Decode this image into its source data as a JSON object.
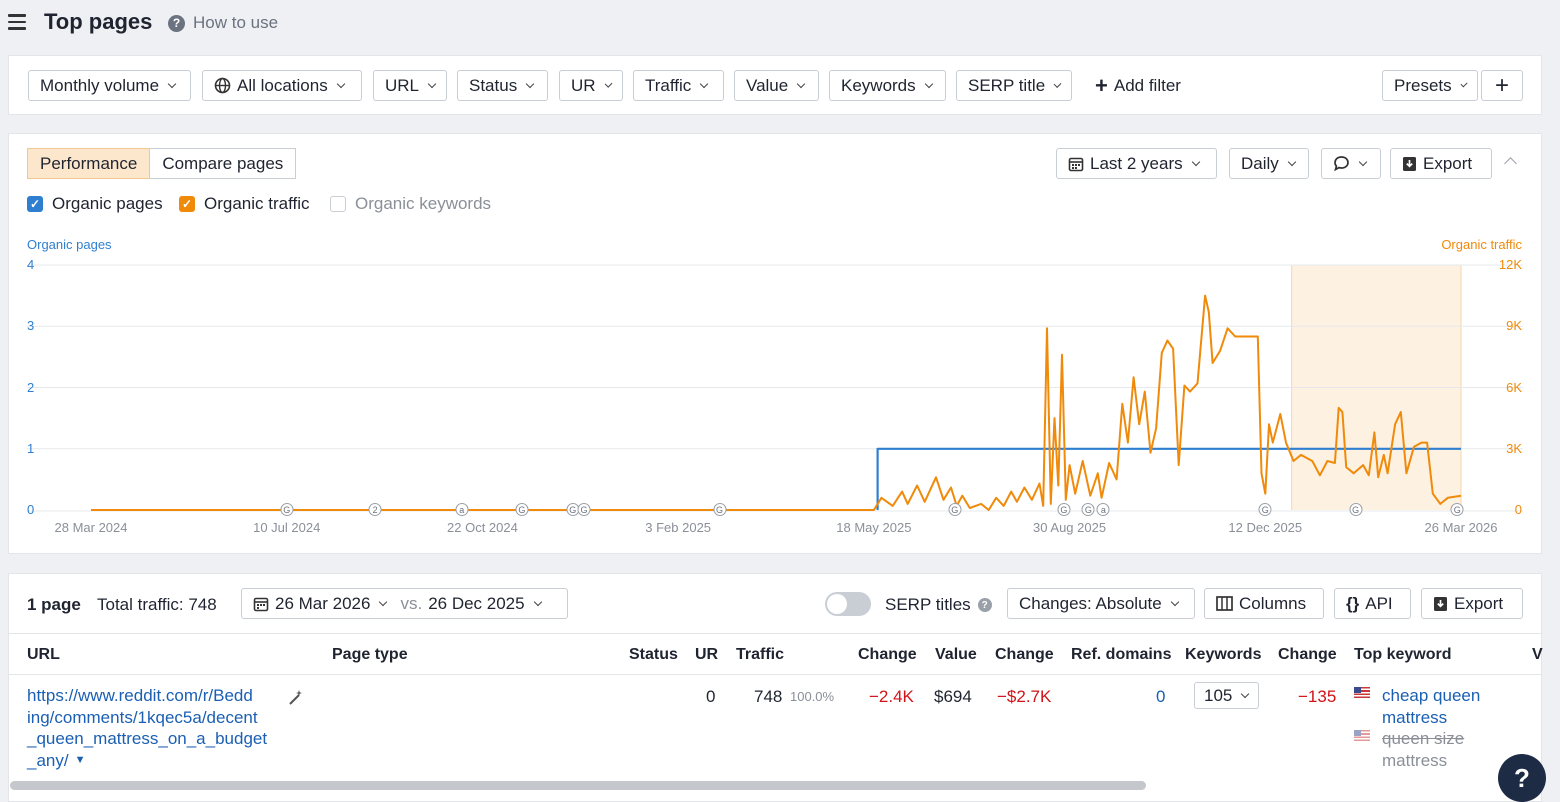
{
  "header": {
    "title": "Top pages",
    "how_to": "How to use",
    "help_glyph": "?"
  },
  "filters": {
    "monthly_volume": "Monthly volume",
    "all_locations": "All locations",
    "url": "URL",
    "status": "Status",
    "ur": "UR",
    "traffic": "Traffic",
    "value": "Value",
    "keywords": "Keywords",
    "serp_title": "SERP title",
    "add_filter": "Add filter",
    "presets": "Presets"
  },
  "chart_panel": {
    "tabs": [
      "Performance",
      "Compare pages"
    ],
    "date_range": "Last 2 years",
    "interval": "Daily",
    "export": "Export",
    "checkboxes": [
      {
        "label": "Organic pages",
        "checked": true,
        "color": "#2f7fd1"
      },
      {
        "label": "Organic traffic",
        "checked": true,
        "color": "#f08a0a"
      },
      {
        "label": "Organic keywords",
        "checked": false,
        "color": "#c9cdd4"
      }
    ]
  },
  "chart_data": {
    "type": "line",
    "left_axis_title": "Organic pages",
    "right_axis_title": "Organic traffic",
    "left_ticks": [
      "0",
      "1",
      "2",
      "3",
      "4"
    ],
    "right_ticks": [
      "0",
      "3K",
      "6K",
      "9K",
      "12K"
    ],
    "ylim_left": [
      0,
      4
    ],
    "ylim_right": [
      0,
      12000
    ],
    "x_ticks": [
      "28 Mar 2024",
      "10 Jul 2024",
      "22 Oct 2024",
      "3 Feb 2025",
      "18 May 2025",
      "30 Aug 2025",
      "12 Dec 2025",
      "26 Mar 2026"
    ],
    "highlight_range": [
      "26 Dec 2025",
      "26 Mar 2026"
    ],
    "grid": true,
    "annotation_markers": [
      {
        "date": "2024-07-10",
        "label": "G"
      },
      {
        "date": "2024-08-26",
        "label": "2"
      },
      {
        "date": "2024-10-11",
        "label": "a"
      },
      {
        "date": "2024-11-12",
        "label": "G"
      },
      {
        "date": "2024-12-09",
        "label": "G"
      },
      {
        "date": "2024-12-15",
        "label": "G"
      },
      {
        "date": "2025-02-25",
        "label": "G"
      },
      {
        "date": "2025-06-30",
        "label": "G"
      },
      {
        "date": "2025-08-27",
        "label": "G"
      },
      {
        "date": "2025-09-09",
        "label": "G"
      },
      {
        "date": "2025-09-17",
        "label": "a"
      },
      {
        "date": "2025-12-12",
        "label": "G"
      },
      {
        "date": "2026-01-29",
        "label": "G"
      },
      {
        "date": "2026-03-24",
        "label": "G"
      }
    ],
    "series": [
      {
        "name": "Organic pages",
        "axis": "left",
        "color": "#2f7fd1",
        "points": [
          [
            "2025-05-20",
            0
          ],
          [
            "2025-05-20",
            1
          ],
          [
            "2026-03-26",
            1
          ]
        ]
      },
      {
        "name": "Organic traffic",
        "axis": "right",
        "color": "#f08a0a",
        "points": [
          [
            "2024-03-28",
            0
          ],
          [
            "2025-05-18",
            0
          ],
          [
            "2025-05-22",
            600
          ],
          [
            "2025-05-28",
            200
          ],
          [
            "2025-06-02",
            900
          ],
          [
            "2025-06-05",
            300
          ],
          [
            "2025-06-10",
            1200
          ],
          [
            "2025-06-14",
            400
          ],
          [
            "2025-06-20",
            1600
          ],
          [
            "2025-06-24",
            500
          ],
          [
            "2025-06-28",
            1100
          ],
          [
            "2025-07-01",
            200
          ],
          [
            "2025-07-04",
            700
          ],
          [
            "2025-07-08",
            100
          ],
          [
            "2025-07-14",
            300
          ],
          [
            "2025-07-18",
            0
          ],
          [
            "2025-07-22",
            600
          ],
          [
            "2025-07-26",
            200
          ],
          [
            "2025-07-30",
            900
          ],
          [
            "2025-08-02",
            400
          ],
          [
            "2025-08-06",
            1100
          ],
          [
            "2025-08-10",
            500
          ],
          [
            "2025-08-14",
            1300
          ],
          [
            "2025-08-16",
            200
          ],
          [
            "2025-08-18",
            8900
          ],
          [
            "2025-08-20",
            300
          ],
          [
            "2025-08-22",
            4500
          ],
          [
            "2025-08-24",
            1200
          ],
          [
            "2025-08-26",
            7600
          ],
          [
            "2025-08-28",
            500
          ],
          [
            "2025-08-30",
            2200
          ],
          [
            "2025-09-02",
            800
          ],
          [
            "2025-09-06",
            2400
          ],
          [
            "2025-09-10",
            700
          ],
          [
            "2025-09-14",
            1800
          ],
          [
            "2025-09-16",
            600
          ],
          [
            "2025-09-20",
            2300
          ],
          [
            "2025-09-24",
            1500
          ],
          [
            "2025-09-27",
            5200
          ],
          [
            "2025-09-30",
            3300
          ],
          [
            "2025-10-03",
            6500
          ],
          [
            "2025-10-06",
            4200
          ],
          [
            "2025-10-09",
            5800
          ],
          [
            "2025-10-12",
            2800
          ],
          [
            "2025-10-15",
            4000
          ],
          [
            "2025-10-18",
            7700
          ],
          [
            "2025-10-21",
            8300
          ],
          [
            "2025-10-24",
            7900
          ],
          [
            "2025-10-27",
            2200
          ],
          [
            "2025-10-30",
            6100
          ],
          [
            "2025-11-02",
            5800
          ],
          [
            "2025-11-06",
            6200
          ],
          [
            "2025-11-10",
            10500
          ],
          [
            "2025-11-12",
            9700
          ],
          [
            "2025-11-14",
            7200
          ],
          [
            "2025-11-18",
            7800
          ],
          [
            "2025-11-22",
            8900
          ],
          [
            "2025-11-26",
            8500
          ],
          [
            "2025-11-30",
            8500
          ],
          [
            "2025-12-08",
            8500
          ],
          [
            "2025-12-10",
            1800
          ],
          [
            "2025-12-12",
            800
          ],
          [
            "2025-12-14",
            4200
          ],
          [
            "2025-12-16",
            3300
          ],
          [
            "2025-12-20",
            4700
          ],
          [
            "2025-12-23",
            3300
          ],
          [
            "2025-12-27",
            2400
          ],
          [
            "2025-12-31",
            2700
          ],
          [
            "2026-01-06",
            2400
          ],
          [
            "2026-01-10",
            1700
          ],
          [
            "2026-01-14",
            2400
          ],
          [
            "2026-01-18",
            2300
          ],
          [
            "2026-01-20",
            5000
          ],
          [
            "2026-01-22",
            4800
          ],
          [
            "2026-01-24",
            2100
          ],
          [
            "2026-01-28",
            1800
          ],
          [
            "2026-02-02",
            2200
          ],
          [
            "2026-02-05",
            1700
          ],
          [
            "2026-02-08",
            3800
          ],
          [
            "2026-02-10",
            1600
          ],
          [
            "2026-02-13",
            2700
          ],
          [
            "2026-02-15",
            1800
          ],
          [
            "2026-02-19",
            4200
          ],
          [
            "2026-02-22",
            4800
          ],
          [
            "2026-02-25",
            1800
          ],
          [
            "2026-03-01",
            3100
          ],
          [
            "2026-03-05",
            3300
          ],
          [
            "2026-03-08",
            3300
          ],
          [
            "2026-03-11",
            800
          ],
          [
            "2026-03-15",
            300
          ],
          [
            "2026-03-19",
            600
          ],
          [
            "2026-03-26",
            700
          ]
        ]
      }
    ]
  },
  "table_toolbar": {
    "page_count": "1 page",
    "total_traffic": "Total traffic: 748",
    "date_a": "26 Mar 2026",
    "vs": "vs.",
    "date_b": "26 Dec 2025",
    "serp_titles": "SERP titles",
    "changes": "Changes: Absolute",
    "columns": "Columns",
    "api": "API",
    "export": "Export"
  },
  "table": {
    "columns": [
      "URL",
      "Page type",
      "Status",
      "UR",
      "Traffic",
      "Change",
      "Value",
      "Change",
      "Ref. domains",
      "Keywords",
      "Change",
      "Top keyword",
      "V"
    ],
    "rows": [
      {
        "url_lines": [
          "https://www.reddit.com/r/Bedd",
          "ing/comments/1kqec5a/decent",
          "_queen_mattress_on_a_budget",
          "_any/"
        ],
        "ur": "0",
        "traffic": "748",
        "traffic_share": "100.0%",
        "traffic_change": "−2.4K",
        "value": "$694",
        "value_change": "−$2.7K",
        "ref_domains": "0",
        "keywords": "105",
        "keywords_change": "−135",
        "top_keyword_lines": [
          "cheap queen",
          "mattress"
        ],
        "second_keyword_lines": [
          "queen size",
          "mattress"
        ]
      }
    ]
  }
}
